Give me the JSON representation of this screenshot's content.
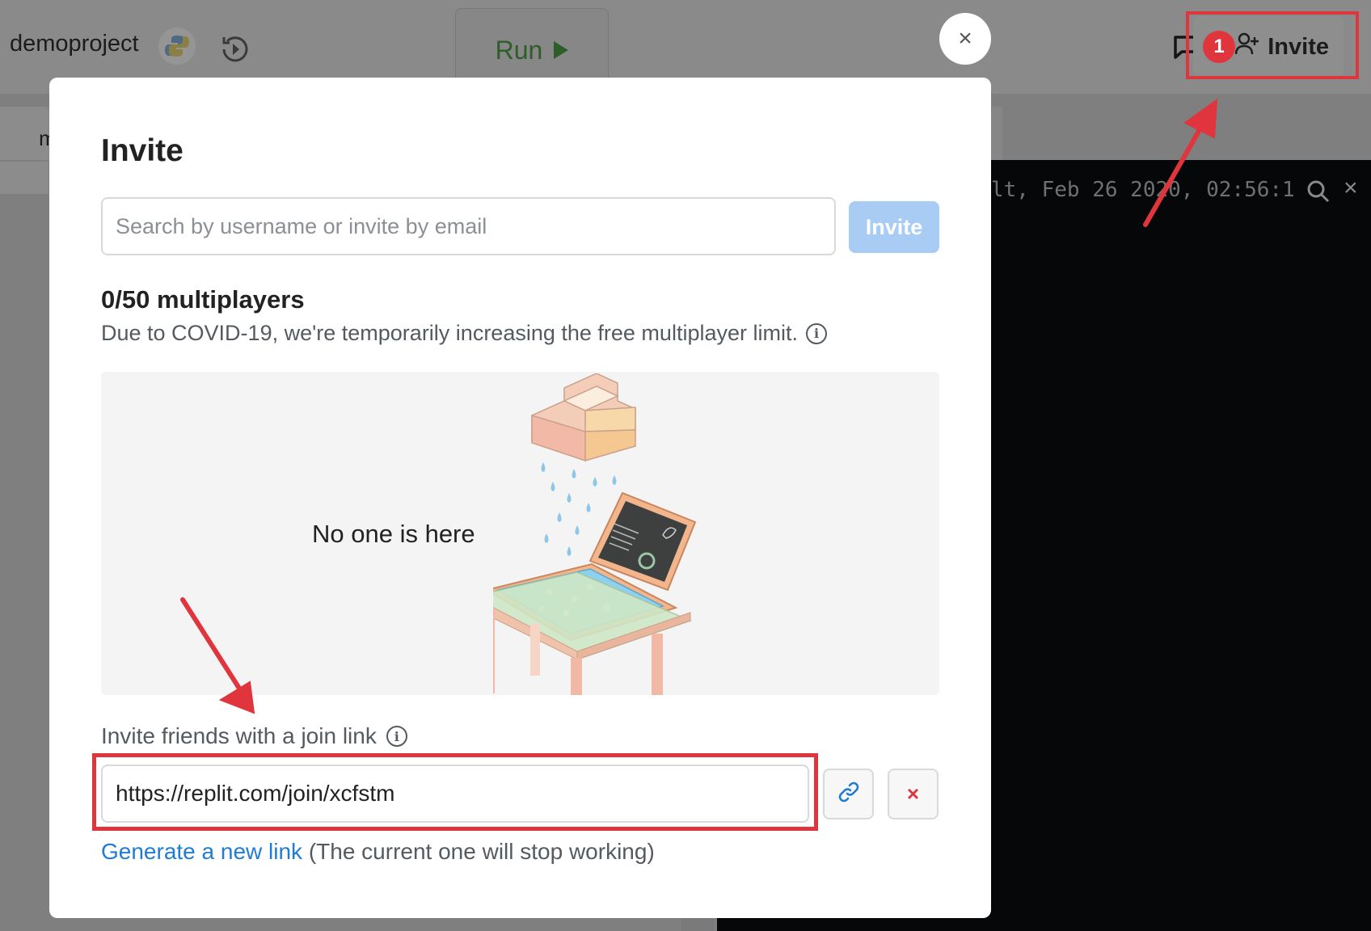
{
  "app": {
    "project_name": "demoproject",
    "run_label": "Run",
    "invite_label": "Invite",
    "notification_count": "1",
    "tab_partial": "m",
    "console_text": "lt, Feb 26 2020, 02:56:1",
    "icons": [
      "python-logo-icon",
      "history-icon",
      "play-icon",
      "chat-icon",
      "add-user-icon",
      "search-icon",
      "close-icon"
    ]
  },
  "modal": {
    "title": "Invite",
    "close_symbol": "×",
    "search_placeholder": "Search by username or invite by email",
    "invite_button": "Invite",
    "multiplayer_count": "0/50 multiplayers",
    "covid_note": "Due to COVID-19, we're temporarily increasing the free multiplayer limit.",
    "empty_state": "No one is here",
    "join_link_label": "Invite friends with a join link",
    "join_link_url": "https://replit.com/join/xcfstm",
    "revoke_symbol": "×",
    "generate_link": "Generate a new link",
    "generate_note": "(The current one will stop working)"
  },
  "colors": {
    "accent_blue": "#1f7cd6",
    "invite_button_disabled": "#a9ccf5",
    "annotation_red": "#e0353d",
    "console_bg": "#060709"
  }
}
